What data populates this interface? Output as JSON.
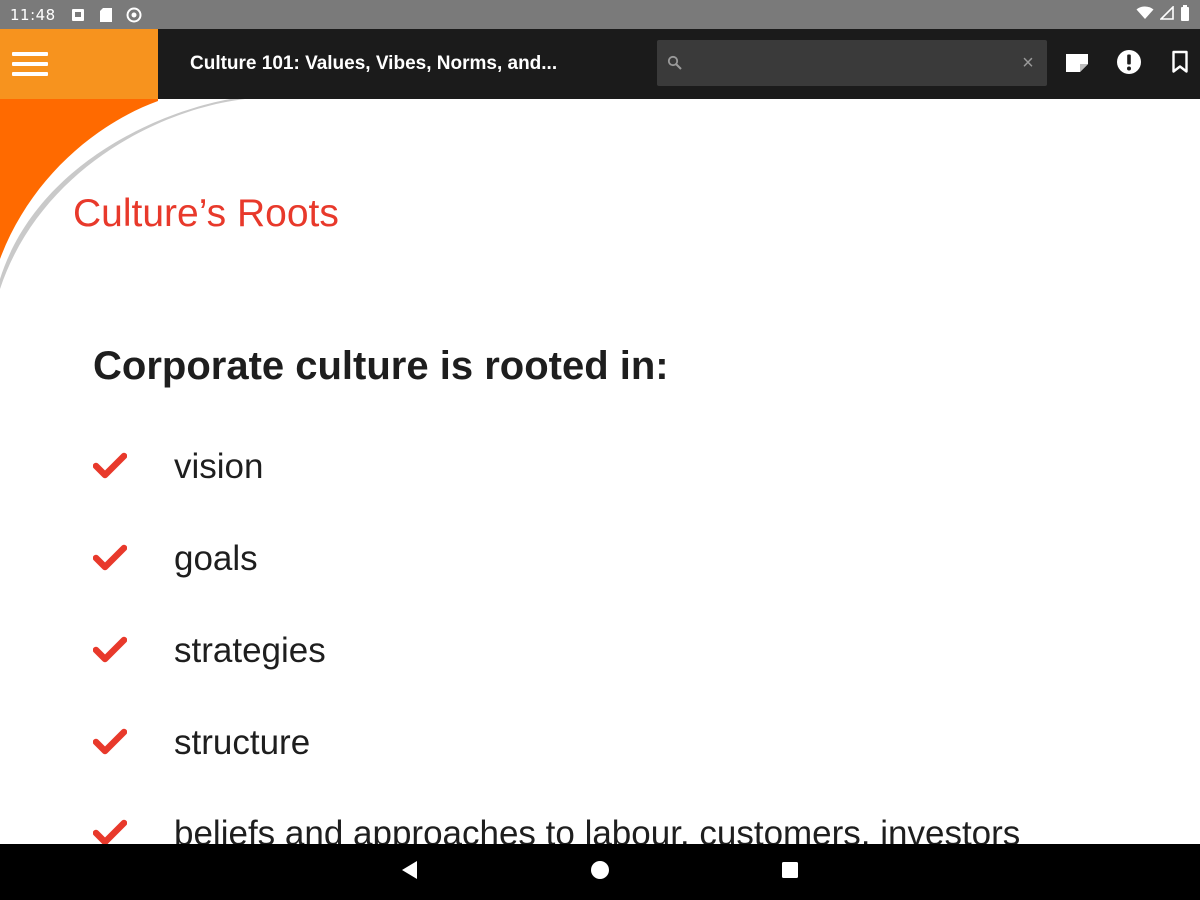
{
  "status_bar": {
    "time": "11:48",
    "left_icons": [
      "notification-icon",
      "sd-card-icon",
      "sync-icon"
    ],
    "right_icons": [
      "wifi-icon",
      "signal-icon",
      "battery-icon"
    ]
  },
  "app_bar": {
    "title": "Culture 101: Values, Vibes, Norms, and...",
    "search": {
      "placeholder": "",
      "value": ""
    },
    "clear_label": "×",
    "actions": [
      "notes-icon",
      "alert-icon",
      "bookmark-icon"
    ]
  },
  "content": {
    "heading": "Culture’s Roots",
    "intro": "Corporate culture is rooted in:",
    "items": [
      "vision",
      "goals",
      "strategies",
      "structure",
      "beliefs and approaches to labour, customers, investors"
    ]
  },
  "nav_bar": {
    "buttons": [
      "back-icon",
      "home-icon",
      "recents-icon"
    ]
  },
  "colors": {
    "accent_red": "#e8392b",
    "orange": "#f7931e",
    "app_bar": "#1b1b1b",
    "status_bar": "#7a7a7a"
  }
}
